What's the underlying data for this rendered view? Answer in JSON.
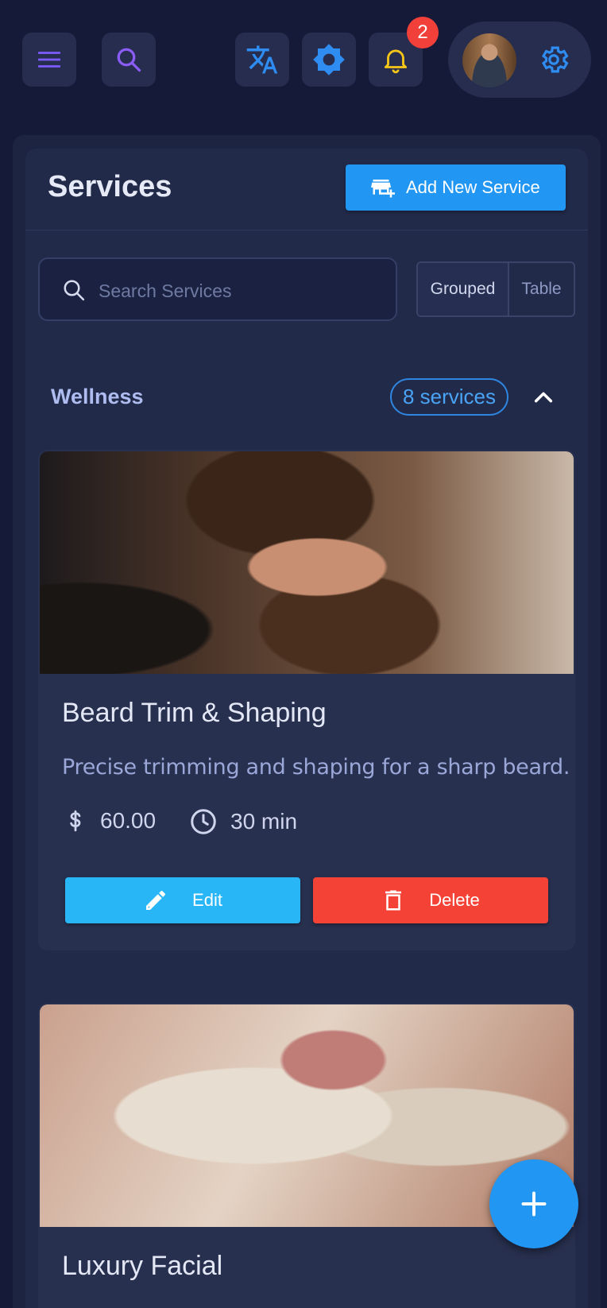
{
  "topbar": {
    "menu_icon": "menu-icon",
    "search_icon": "search-icon",
    "translate_icon": "translate-icon",
    "theme_icon": "brightness-icon",
    "notifications_icon": "bell-icon",
    "notification_count": "2",
    "settings_icon": "gear-icon"
  },
  "page": {
    "title": "Services",
    "add_button_label": "Add New Service"
  },
  "search": {
    "placeholder": "Search Services",
    "value": ""
  },
  "view_toggle": {
    "options": [
      "Grouped",
      "Table"
    ],
    "selected": "Grouped"
  },
  "category": {
    "name": "Wellness",
    "count_label": "8 services",
    "collapsed": false
  },
  "services": [
    {
      "name": "Beard Trim & Shaping",
      "description": "Precise trimming and shaping for a sharp beard.",
      "price": "60.00",
      "duration": "30 min",
      "edit_label": "Edit",
      "delete_label": "Delete"
    },
    {
      "name": "Luxury Facial"
    }
  ],
  "colors": {
    "background": "#141a38",
    "panel": "#222a4a",
    "primary": "#2196f3",
    "edit": "#29b6f6",
    "delete": "#f44336",
    "badge": "#f1403a"
  }
}
